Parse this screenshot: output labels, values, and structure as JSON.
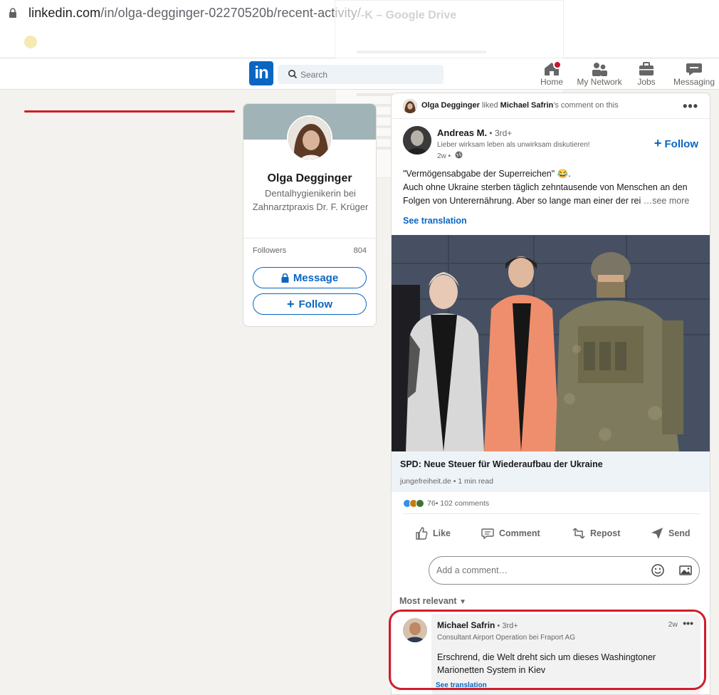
{
  "browser": {
    "url_main": "linkedin.com",
    "url_path": "/in/olga-degginger-02270520b/recent-activity/",
    "ghost_title": "-K – Google Drive"
  },
  "nav": {
    "search_placeholder": "Search",
    "items": [
      {
        "label": "Home",
        "icon": "home-icon"
      },
      {
        "label": "My Network",
        "icon": "people-icon"
      },
      {
        "label": "Jobs",
        "icon": "briefcase-icon"
      },
      {
        "label": "Messaging",
        "icon": "chat-icon"
      }
    ]
  },
  "profile": {
    "name": "Olga Degginger",
    "headline": "Dentalhygienikerin bei Zahnarztpraxis Dr. F. Krüger",
    "followers_label": "Followers",
    "followers_count": "804",
    "message_label": "Message",
    "follow_label": "Follow"
  },
  "activity": {
    "actor": "Olga Degginger",
    "verb": " liked ",
    "target": "Michael Safrin",
    "suffix": "'s comment on this"
  },
  "post": {
    "author_name": "Andreas M.",
    "author_degree": " • 3rd+",
    "author_headline": "Lieber wirksam leben als unwirksam diskutieren!",
    "time": "2w •",
    "follow_label": "Follow",
    "text_line1": "\"Vermögensabgabe der Superreichen\" 😂.",
    "text_line2": "Auch ohne Ukraine sterben täglich zehntausende von Menschen an den Folgen von Unterernährung. Aber so lange man einer der rei",
    "see_more": " …see more",
    "see_translation": "See translation",
    "article_title": "SPD: Neue Steuer für Wiederaufbau der Ukraine",
    "article_source": "jungefreiheit.de • 1 min read",
    "reactions_count": "76",
    "comments_count": " • 102 comments",
    "actions": {
      "like": "Like",
      "comment": "Comment",
      "repost": "Repost",
      "send": "Send"
    },
    "comment_placeholder": "Add a comment…",
    "sort_label": "Most relevant"
  },
  "comment": {
    "author_name": "Michael Safrin",
    "author_degree": " • 3rd+",
    "author_headline": "Consultant Airport Operation bei Fraport AG",
    "time": "2w",
    "text": "Erschrend, die Welt dreht sich um dieses Washingtoner Marionetten System in Kiev",
    "see_translation": "See translation"
  },
  "colors": {
    "linkedin_blue": "#0a66c2",
    "highlight_red": "#d11d2a",
    "background": "#f3f2ef"
  }
}
